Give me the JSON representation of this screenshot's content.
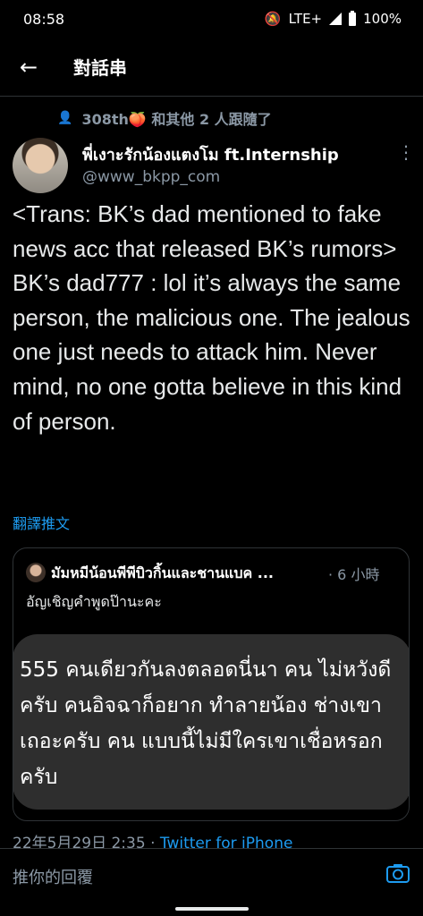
{
  "status": {
    "time": "08:58",
    "network": "LTE+",
    "battery": "100%"
  },
  "header": {
    "title": "對話串"
  },
  "follow_note": {
    "text": "308th🍑 和其他 2 人跟隨了"
  },
  "tweet": {
    "display_name": "พี่เงาะรักน้องแตงโม ft.Internship",
    "handle": "@www_bkpp_com",
    "text_lines": [
      "<Trans: BK’s dad mentioned to fake news acc that released BK’s rumors>",
      "BK’s dad777 : lol it’s always the same person, the malicious one. The jealous one just needs to attack him. Never mind, no one gotta believe in this kind of person."
    ],
    "translate_label": "翻譯推文",
    "timestamp": "22年5月29日 2:35",
    "source": "Twitter for iPhone"
  },
  "quote": {
    "display_name": "มัมหมีน้อนพีพีบิวกิ้นและชานแบค ...",
    "time": "· 6 小時",
    "line2": "อัญเชิญคำพูดป๊านะคะ",
    "bubble_text": "555 คนเดียวกันลงตลอดนี่นา คน ไม่หวังดีครับ คนอิจฉาก็อยาก ทำลายน้อง ช่างเขาเถอะครับ คน แบบนี้ไม่มีใครเขาเชื่อหรอกครับ"
  },
  "reply": {
    "placeholder": "推你的回覆"
  },
  "colors": {
    "accent": "#1d9bf0",
    "background": "#000000",
    "muted": "#8b98a5"
  }
}
